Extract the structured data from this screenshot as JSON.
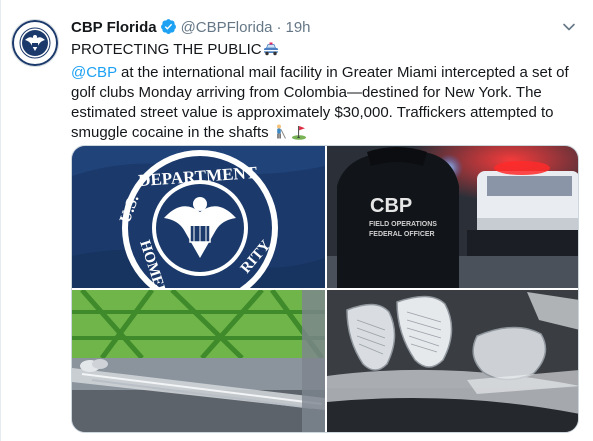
{
  "tweet": {
    "author_name": "CBP Florida",
    "handle": "@CBPFlorida",
    "separator": "·",
    "time": "19h",
    "headline": "PROTECTING THE PUBLIC",
    "mention": "@CBP",
    "body": " at the international mail facility in Greater Miami intercepted a set of golf clubs Monday arriving from Colombia—destined for New York. The estimated street value is approximately $30,000. Traffickers attempted to smuggle cocaine in the shafts",
    "emojis": [
      "police-car-icon",
      "golfer-icon",
      "golf-flag-icon"
    ]
  },
  "media": {
    "seal_text_top": "DEPARTMENT",
    "seal_text_left": "U.S.",
    "seal_text_left2": "HOMEL",
    "seal_text_right": "RITY",
    "vest_title": "CBP",
    "vest_line1": "FIELD OPERATIONS",
    "vest_line2": "FEDERAL OFFICER"
  },
  "colors": {
    "link": "#1da1f2",
    "muted": "#657786",
    "verified": "#1da1f2",
    "seal_blue": "#1b3a6b"
  }
}
